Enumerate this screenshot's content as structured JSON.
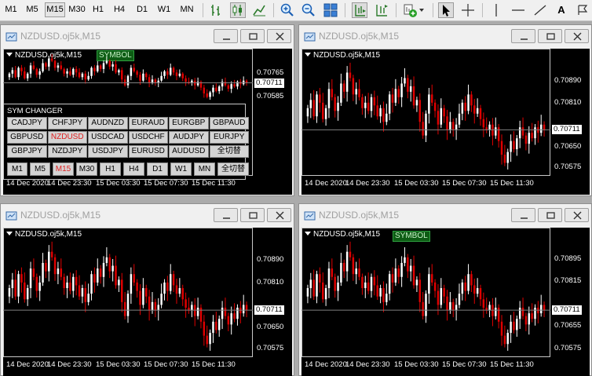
{
  "toolbar": {
    "timeframes": [
      "M1",
      "M5",
      "M15",
      "M30",
      "H1",
      "H4",
      "D1",
      "W1",
      "MN"
    ],
    "active_timeframe": "M15",
    "text_tool_label": "A"
  },
  "colors": {
    "bull": "#ffffff",
    "bear": "#e00000",
    "neutral": "#2bbf2b",
    "background": "#000000",
    "price_line": "#808080"
  },
  "windows": [
    {
      "title": "NZDUSD.oj5k,M15",
      "chart_title": "NZDUSD.oj5k,M15",
      "symbol_tag": "SYMBOL",
      "price_labels": [
        "0.70765",
        "0.70585"
      ],
      "current_price": "0.70711",
      "time_labels": [
        "14 Dec 2020",
        "14 Dec 23:30",
        "15 Dec 03:30",
        "15 Dec 07:30",
        "15 Dec 11:30"
      ],
      "panel": {
        "title": "SYM CHANGER",
        "rows": [
          [
            "CADJPY",
            "CHFJPY",
            "AUDNZD",
            "EURAUD",
            "EURGBP",
            "GBPAUD"
          ],
          [
            "GBPUSD",
            "NZDUSD",
            "USDCAD",
            "USDCHF",
            "AUDJPY",
            "EURJPY"
          ],
          [
            "GBPJPY",
            "NZDJPY",
            "USDJPY",
            "EURUSD",
            "AUDUSD",
            "全切替"
          ]
        ],
        "selected_symbol": "NZDUSD",
        "timeframes": [
          "M1",
          "M5",
          "M15",
          "M30",
          "H1",
          "H4",
          "D1",
          "W1",
          "MN",
          "全切替"
        ],
        "selected_timeframe": "M15"
      }
    },
    {
      "title": "NZDUSD.oj5k,M15",
      "chart_title": "NZDUSD.oj5k,M15",
      "price_labels": [
        "0.70890",
        "0.70810",
        "0.70650",
        "0.70575"
      ],
      "current_price": "0.70711",
      "time_labels": [
        "14 Dec 2020",
        "14 Dec 23:30",
        "15 Dec 03:30",
        "15 Dec 07:30",
        "15 Dec 11:30"
      ]
    },
    {
      "title": "NZDUSD.oj5k,M15",
      "chart_title": "NZDUSD.oj5k,M15",
      "price_labels": [
        "0.70890",
        "0.70810",
        "0.70650",
        "0.70575"
      ],
      "current_price": "0.70711",
      "time_labels": [
        "14 Dec 2020",
        "14 Dec 23:30",
        "15 Dec 03:30",
        "15 Dec 07:30",
        "15 Dec 11:30"
      ]
    },
    {
      "title": "NZDUSD.oj5k,M15",
      "chart_title": "NZDUSD.oj5k,M15",
      "symbol_tag": "SYMBOL",
      "price_labels": [
        "0.70895",
        "0.70815",
        "0.70655",
        "0.70575"
      ],
      "current_price": "0.70711",
      "time_labels": [
        "14 Dec 2020",
        "14 Dec 23:30",
        "15 Dec 03:30",
        "15 Dec 07:30",
        "15 Dec 11:30"
      ]
    }
  ],
  "chart_data": {
    "type": "candlestick",
    "symbol": "NZDUSD.oj5k",
    "timeframe": "M15",
    "current_price": 0.70711,
    "close": [
      0.7079,
      0.7082,
      0.7076,
      0.7084,
      0.7081,
      0.7075,
      0.7079,
      0.7086,
      0.7083,
      0.7078,
      0.7081,
      0.7088,
      0.7085,
      0.7092,
      0.709,
      0.7084,
      0.7086,
      0.7083,
      0.7079,
      0.7081,
      0.7078,
      0.7083,
      0.708,
      0.7076,
      0.7079,
      0.7074,
      0.7077,
      0.7084,
      0.7081,
      0.7086,
      0.7083,
      0.7088,
      0.709,
      0.7085,
      0.7087,
      0.708,
      0.7082,
      0.7074,
      0.7069,
      0.7077,
      0.7084,
      0.7081,
      0.7078,
      0.7073,
      0.7079,
      0.7076,
      0.7071,
      0.7074,
      0.7071,
      0.7073,
      0.7077,
      0.7081,
      0.7078,
      0.7084,
      0.708,
      0.7077,
      0.7079,
      0.7075,
      0.7072,
      0.7071,
      0.7073,
      0.7069,
      0.7072,
      0.7067,
      0.7062,
      0.7059,
      0.7063,
      0.7067,
      0.7064,
      0.7068,
      0.7072,
      0.7069,
      0.7066,
      0.707,
      0.7068,
      0.7072,
      0.707,
      0.7073,
      0.7071
    ],
    "open": [
      0.7076,
      0.7079,
      0.7082,
      0.7076,
      0.7084,
      0.7081,
      0.7075,
      0.7079,
      0.7086,
      0.7083,
      0.7078,
      0.7081,
      0.7088,
      0.7085,
      0.7092,
      0.709,
      0.7084,
      0.7086,
      0.7083,
      0.7079,
      0.7081,
      0.7078,
      0.7083,
      0.708,
      0.7076,
      0.7079,
      0.7074,
      0.7077,
      0.7084,
      0.7081,
      0.7086,
      0.7083,
      0.7088,
      0.709,
      0.7085,
      0.7087,
      0.708,
      0.7082,
      0.7074,
      0.7069,
      0.7077,
      0.7084,
      0.7081,
      0.7078,
      0.7073,
      0.7079,
      0.7076,
      0.7071,
      0.7074,
      0.7071,
      0.7073,
      0.7077,
      0.7081,
      0.7078,
      0.7084,
      0.708,
      0.7077,
      0.7079,
      0.7075,
      0.7072,
      0.7071,
      0.7073,
      0.7069,
      0.7072,
      0.7067,
      0.7062,
      0.7059,
      0.7063,
      0.7067,
      0.7064,
      0.7068,
      0.7072,
      0.7069,
      0.7066,
      0.707,
      0.7068,
      0.7072,
      0.707,
      0.7073
    ]
  }
}
